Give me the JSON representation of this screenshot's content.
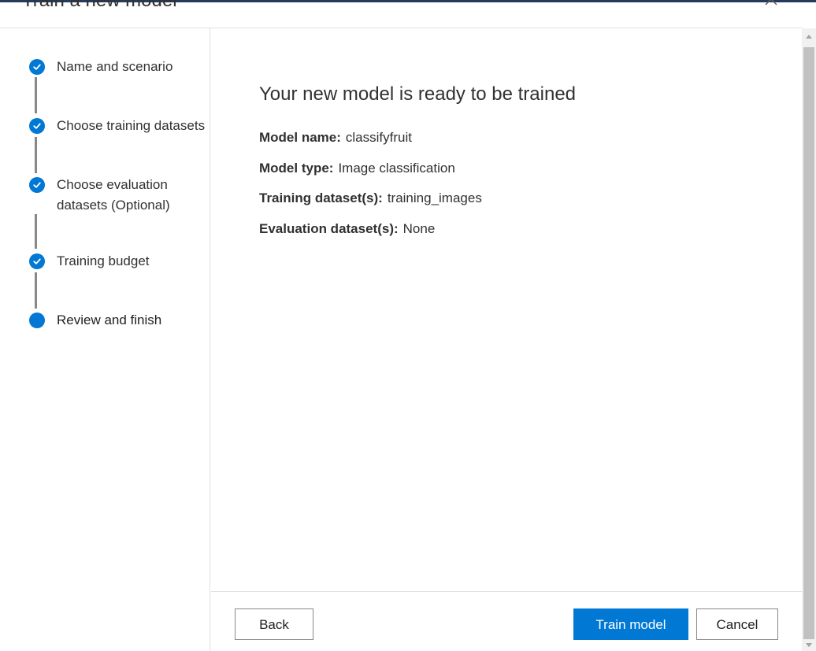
{
  "dialog": {
    "title": "Train a new model"
  },
  "steps": [
    {
      "label": "Name and scenario",
      "state": "completed"
    },
    {
      "label": "Choose training datasets",
      "state": "completed"
    },
    {
      "label": "Choose evaluation datasets (Optional)",
      "state": "completed"
    },
    {
      "label": "Training budget",
      "state": "completed"
    },
    {
      "label": "Review and finish",
      "state": "current"
    }
  ],
  "main": {
    "heading": "Your new model is ready to be trained",
    "details": [
      {
        "key": "Model name:",
        "value": "classifyfruit"
      },
      {
        "key": "Model type:",
        "value": "Image classification"
      },
      {
        "key": "Training dataset(s):",
        "value": "training_images"
      },
      {
        "key": "Evaluation dataset(s):",
        "value": "None"
      }
    ]
  },
  "footer": {
    "back_label": "Back",
    "train_label": "Train model",
    "cancel_label": "Cancel"
  },
  "icons": {
    "completed_step": "checkmark-icon",
    "current_step": "filled-circle-icon",
    "close": "close-icon"
  },
  "colors": {
    "accent": "#0078d4",
    "text": "#323130",
    "divider": "#e1dfdd",
    "connector": "#8a8886"
  }
}
